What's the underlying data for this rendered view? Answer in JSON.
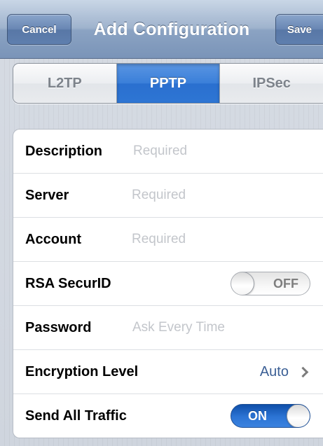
{
  "navbar": {
    "title": "Add Configuration",
    "cancel_label": "Cancel",
    "save_label": "Save"
  },
  "vpn_types": {
    "options": [
      "L2TP",
      "PPTP",
      "IPSec"
    ],
    "selected": "PPTP"
  },
  "form": {
    "description": {
      "label": "Description",
      "placeholder": "Required"
    },
    "server": {
      "label": "Server",
      "placeholder": "Required"
    },
    "account": {
      "label": "Account",
      "placeholder": "Required"
    },
    "rsa_securid": {
      "label": "RSA SecurID",
      "state": "OFF"
    },
    "password": {
      "label": "Password",
      "placeholder": "Ask Every Time"
    },
    "encryption_level": {
      "label": "Encryption Level",
      "value": "Auto"
    },
    "send_all_traffic": {
      "label": "Send All Traffic",
      "state": "ON"
    }
  },
  "colors": {
    "accent": "#2e76d4",
    "navbar": "#8ba3c3",
    "detail_value": "#3b5f95"
  }
}
